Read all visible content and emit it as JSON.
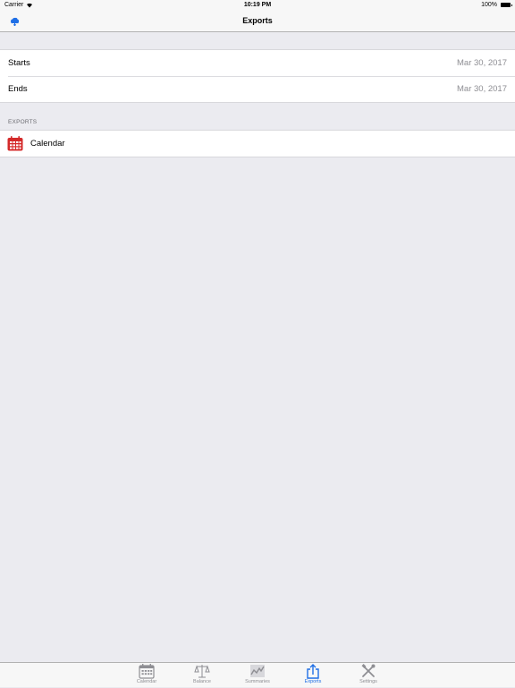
{
  "status_bar": {
    "carrier": "Carrier",
    "time": "10:19 PM",
    "battery": "100%"
  },
  "nav": {
    "title": "Exports",
    "left_icon": "cloud-icon"
  },
  "date_range": [
    {
      "label": "Starts",
      "value": "Mar 30, 2017"
    },
    {
      "label": "Ends",
      "value": "Mar 30, 2017"
    }
  ],
  "exports": {
    "header": "EXPORTS",
    "items": [
      {
        "label": "Calendar",
        "icon": "calendar-icon",
        "color": "#d42a2a"
      }
    ]
  },
  "tabs": [
    {
      "label": "Calendar",
      "icon": "calendar-icon"
    },
    {
      "label": "Balance",
      "icon": "scale-icon"
    },
    {
      "label": "Summaries",
      "icon": "chart-icon"
    },
    {
      "label": "Exports",
      "icon": "share-icon",
      "active": true
    },
    {
      "label": "Settings",
      "icon": "tools-icon"
    }
  ],
  "colors": {
    "accent": "#1f6fe6",
    "inactive": "#8e8e93",
    "background": "#ebebf0"
  }
}
